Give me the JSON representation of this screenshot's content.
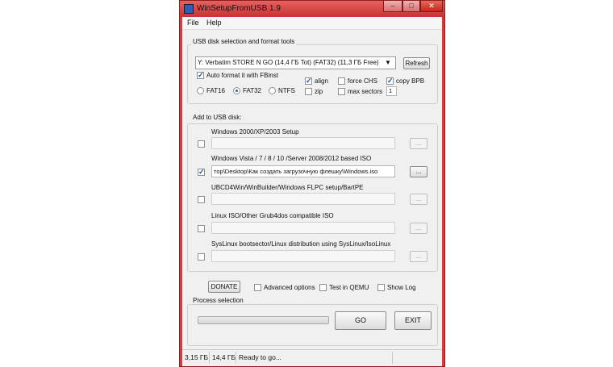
{
  "window": {
    "title": "WinSetupFromUSB 1.9",
    "controls": {
      "minimize": "–",
      "maximize": "□",
      "close": "✕"
    }
  },
  "menu": {
    "items": [
      "File",
      "Help"
    ]
  },
  "usb_group": {
    "label": "USB disk selection and format tools",
    "disk_selected": "Y: Verbatim STORE N GO (14,4 ГБ Tot) (FAT32) (11,3 ГБ Free)",
    "refresh_label": "Refresh",
    "autoformat_label": "Auto format it with FBinst",
    "autoformat_checked": true,
    "fs": {
      "fat16": "FAT16",
      "fat32": "FAT32",
      "ntfs": "NTFS",
      "selected": "FAT32"
    },
    "align_label": "align",
    "align_checked": true,
    "zip_label": "zip",
    "zip_checked": false,
    "force_chs_label": "force CHS",
    "force_chs_checked": false,
    "max_sectors_label": "max sectors",
    "max_sectors_checked": false,
    "max_sectors_value": "1",
    "copy_bpb_label": "copy BPB",
    "copy_bpb_checked": true
  },
  "add_group": {
    "label": "Add to USB disk:",
    "items": [
      {
        "label": "Windows 2000/XP/2003 Setup",
        "checked": false,
        "path": ""
      },
      {
        "label": "Windows Vista / 7 / 8 / 10 /Server 2008/2012 based ISO",
        "checked": true,
        "path": "тор\\Desktop\\Как создать загрузочную флешку\\Windows.iso"
      },
      {
        "label": "UBCD4Win/WinBuilder/Windows FLPC setup/BartPE",
        "checked": false,
        "path": ""
      },
      {
        "label": "Linux ISO/Other Grub4dos compatible ISO",
        "checked": false,
        "path": ""
      },
      {
        "label": "SysLinux bootsector/Linux distribution using SysLinux/IsoLinux",
        "checked": false,
        "path": ""
      }
    ],
    "browse_label": "..."
  },
  "options": {
    "donate_label": "DONATE",
    "advanced_label": "Advanced options",
    "test_qemu_label": "Test in QEMU",
    "show_log_label": "Show Log"
  },
  "process": {
    "label": "Process selection",
    "progress": 0,
    "go_label": "GO",
    "exit_label": "EXIT"
  },
  "status": {
    "used": "3,15 ГБ",
    "total": "14,4 ГБ",
    "message": "Ready to go..."
  }
}
